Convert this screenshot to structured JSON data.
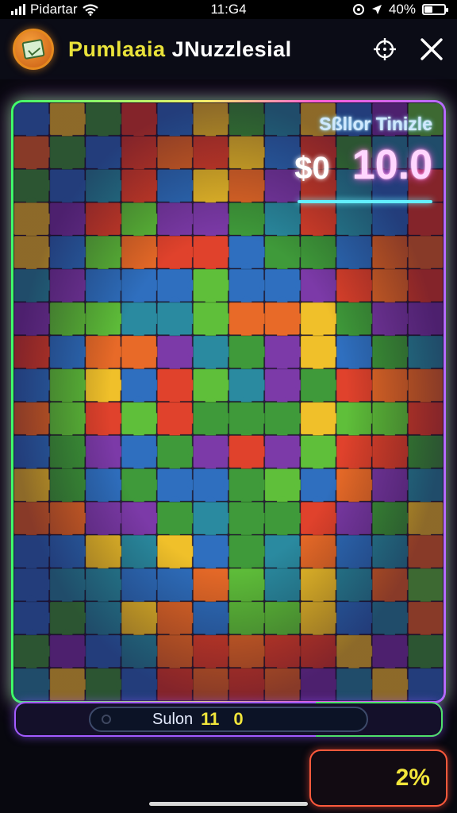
{
  "status_bar": {
    "carrier": "Pidartar",
    "time": "11:G4",
    "battery": "40%",
    "icons": [
      "signal-icon",
      "wifi-icon",
      "location-icon",
      "navigation-icon",
      "battery-icon"
    ]
  },
  "header": {
    "title_part1": "Pumlaaia",
    "title_part2": "JNuzzlesial",
    "icons": [
      "puzzle-app-icon",
      "crosshair-icon",
      "close-icon"
    ]
  },
  "overlay": {
    "label": "Sßllor Tinizle",
    "currency": "$0",
    "amount": "10.0"
  },
  "footer": {
    "status_label": "Sulon",
    "status_count": "11",
    "status_zero": "0",
    "percent": "2%"
  },
  "colors": {
    "board_palette": [
      "#3f9a3a",
      "#e0422c",
      "#7c3aa8",
      "#2f6fbf",
      "#f0c02a",
      "#e86a28",
      "#5fbf3a",
      "#2a8aa0"
    ],
    "accent_green": "#3eff6a",
    "accent_pink": "#ff5fd8",
    "accent_yellow": "#f1e53b"
  }
}
